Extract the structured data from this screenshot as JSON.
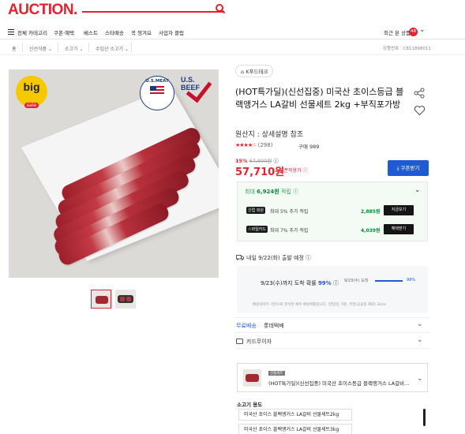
{
  "header": {
    "logo": "AUCTION.",
    "search_placeholder": "",
    "accent": "#e3232d"
  },
  "nav": {
    "menu_label": "전체 카테고리",
    "items": [
      "쿠폰·혜택",
      "베스트",
      "스타배송",
      "꼭 챙겨요",
      "사업자 클럽"
    ],
    "recent_label": "최근 본 상품",
    "recent_count": "48"
  },
  "breadcrumb": {
    "items": [
      "홈",
      "신선식품",
      "소고기",
      "수입산 소고기"
    ],
    "product_code": "상품번호 : C811898011"
  },
  "gallery": {
    "badge_main": "big",
    "badge_sub": "sale",
    "cert1": "U.S.MEAT",
    "cert2": "U.S. BEEF",
    "thumbnails": [
      "thumb-1",
      "thumb-2"
    ]
  },
  "product": {
    "brand": "K푸드테크",
    "title": "(HOT특가딜)(신선집중) 미국산 초이스등급 블랙앵거스 LA갈비 선물세트 2kg +부직포가방",
    "origin": "원산지 : 상세설명 참조",
    "stars": "★★★★☆",
    "review_count": "(298)",
    "orders": "구매 989",
    "discount_pct": "15%",
    "original_price": "67,900원",
    "price": "57,710원",
    "price_note": "쿠폰적용가 ⓘ",
    "coupon_button": "⤓ 쿠폰받기"
  },
  "saving": {
    "head_prefix": "최대 ",
    "head_amount": "6,924원",
    "head_suffix": " 적립 ⓘ",
    "rows": [
      {
        "pill": "클럽 회원",
        "label": "최대 5% 추가 적립",
        "amount": "2,885원",
        "button": "지금보기"
      },
      {
        "pill": "스마일카드",
        "label": "최대 7% 추가 적립",
        "amount": "4,039원",
        "button": "혜택받기"
      }
    ]
  },
  "shipping": {
    "head": "내일 9/22(화) 출발 예정 ⓘ",
    "main_prefix": "9/23(수)까지 도착 확률 ",
    "main_pct": "99%",
    "bar_label": "9/23(수) 도착",
    "bar_pct": "99%",
    "bar_value": 0.99,
    "note": "배송데이터 기반으로 분석한 예측 배송확률입니다. (영업일 기준, 주말/공휴일 제외) 3k/ss"
  },
  "delivery": {
    "free_label": "무료배송",
    "carrier": "롯데택배",
    "card_label": "카드무이자"
  },
  "option": {
    "tag": "선물세트",
    "text": "(HOT특가딜)(신선집중) 미국산 초이스등급 블랙앵거스 LA갈비 선물세트..."
  },
  "usage": {
    "label": "소고기 용도",
    "items": [
      "미국산 초이스 블랙앵거스 LA갈비 선물세트2kg",
      "미국산 초이스 블랙앵거스 LA갈비 선물세트3kg"
    ]
  }
}
